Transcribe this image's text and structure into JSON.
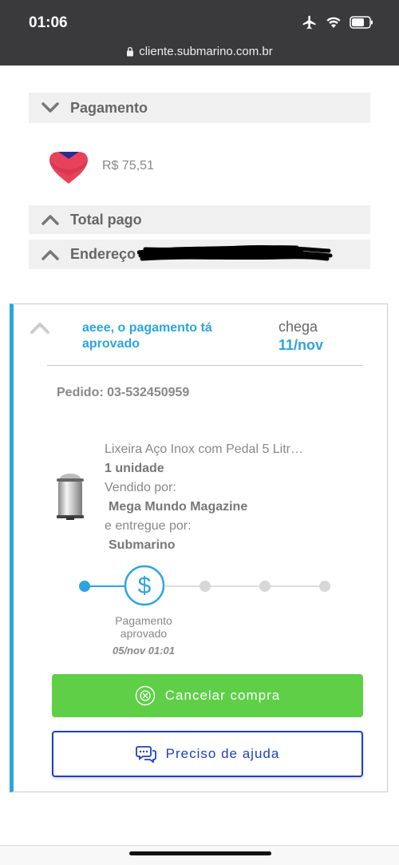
{
  "status_bar": {
    "time": "01:06",
    "url": "cliente.submarino.com.br"
  },
  "payment_section": {
    "title": "Pagamento",
    "amount": "R$ 75,51"
  },
  "total_section": {
    "title": "Total pago"
  },
  "address_section": {
    "title": "Endereço"
  },
  "order": {
    "status_message": "aeee, o pagamento tá aprovado",
    "arrives_label": "chega",
    "arrives_date": "11/nov",
    "order_number": "Pedido: 03-532450959",
    "product_name": "Lixeira Aço Inox com Pedal 5 Litr…",
    "quantity": "1 unidade",
    "sold_by_label": "Vendido por:",
    "seller": "Mega Mundo Magazine",
    "delivered_by_label": "e entregue por:",
    "deliverer": "Submarino"
  },
  "timeline": {
    "step_label": "Pagamento aprovado",
    "step_date": "05/nov 01:01",
    "active_step": 2,
    "total_steps": 5
  },
  "actions": {
    "cancel_label": "Cancelar compra",
    "help_label": "Preciso de ajuda"
  },
  "colors": {
    "accent": "#2da4e0",
    "cancel_bg": "#5ecf47",
    "help_border": "#1c3fc5"
  }
}
